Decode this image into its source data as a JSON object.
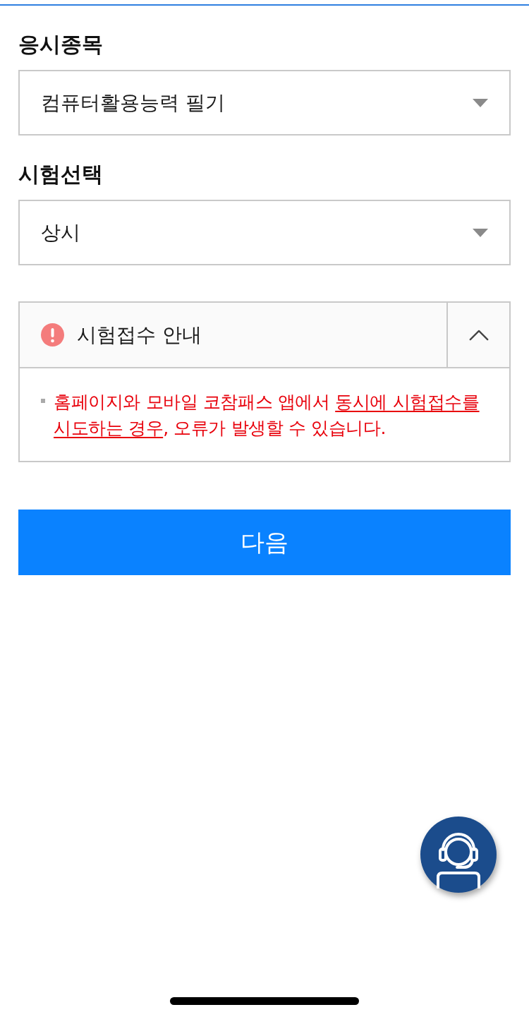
{
  "fields": [
    {
      "label": "응시종목",
      "value": "컴퓨터활용능력 필기"
    },
    {
      "label": "시험선택",
      "value": "상시"
    }
  ],
  "notice": {
    "title": "시험접수 안내",
    "expanded": true,
    "items": [
      {
        "parts": [
          {
            "text": "홈페이지와 모바일 코참패스 앱에서 ",
            "underline": false
          },
          {
            "text": "동시에 시험접수를 시도하는 경우",
            "underline": true
          },
          {
            "text": ", 오류가 발생할 수 있습니다.",
            "underline": false
          }
        ]
      }
    ]
  },
  "next_button": {
    "label": "다음"
  }
}
